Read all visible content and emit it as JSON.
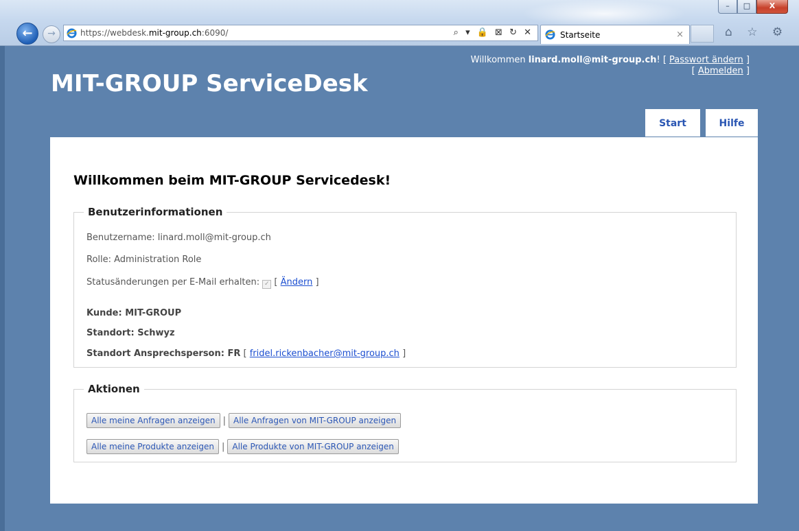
{
  "browser": {
    "url_prefix": "https://webdesk.",
    "url_domain": "mit-group.ch",
    "url_suffix": ":6090/",
    "tab_title": "Startseite",
    "tab_close": "×",
    "address_tools": "⌕ ▾ 🔒 ⊠ ↻ ✕",
    "right_icons": "⌂ ☆ ⚙",
    "window_buttons": {
      "minimize": "–",
      "maximize": "□",
      "close": "X"
    }
  },
  "header": {
    "welcome_prefix": "Willkommen ",
    "user_email": "linard.moll@mit-group.ch",
    "welcome_suffix": "! [ ",
    "change_password": "Passwort ändern",
    "close_bracket": " ]",
    "logout_open": "[ ",
    "logout": "Abmelden",
    "logout_close": " ]",
    "brand": "MIT-GROUP ServiceDesk"
  },
  "nav": {
    "start": "Start",
    "help": "Hilfe"
  },
  "main": {
    "title": "Willkommen beim MIT-GROUP Servicedesk!",
    "user_info": {
      "legend": "Benutzerinformationen",
      "username": "Benutzername: linard.moll@mit-group.ch",
      "role": "Rolle: Administration Role",
      "status_label": "Statusänderungen per E-Mail erhalten:",
      "status_checked": true,
      "change_open": " [ ",
      "change_link": "Ändern",
      "change_close": " ]",
      "customer": "Kunde: MIT-GROUP",
      "location": "Standort: Schwyz",
      "contact_label": "Standort Ansprechsperson: FR",
      "contact_open": " [ ",
      "contact_email": "fridel.rickenbacher@mit-group.ch",
      "contact_close": " ]"
    },
    "actions": {
      "legend": "Aktionen",
      "separator": "|",
      "my_requests": "Alle meine Anfragen anzeigen",
      "all_requests": "Alle Anfragen von MIT-GROUP anzeigen",
      "my_products": "Alle meine Produkte anzeigen",
      "all_products": "Alle Produkte von MIT-GROUP anzeigen"
    }
  },
  "colors": {
    "page_bg": "#5d82ad",
    "link": "#1b4ed0",
    "nav_text": "#2a56b3"
  }
}
